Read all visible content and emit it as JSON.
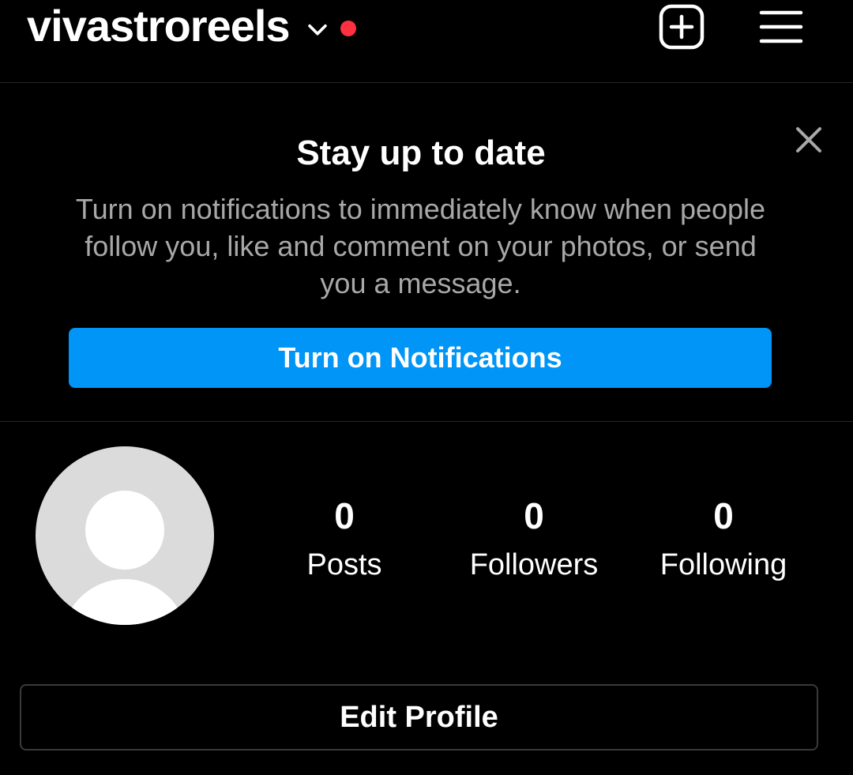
{
  "header": {
    "username": "vivastroreels",
    "chevron_icon": "chevron-down-icon",
    "notification_dot_color": "#ff3040",
    "new_post_icon": "plus-square-icon",
    "menu_icon": "hamburger-menu-icon"
  },
  "banner": {
    "title": "Stay up to date",
    "body": "Turn on notifications to immediately know when people follow you, like and comment on your photos, or send you a message.",
    "button_label": "Turn on Notifications",
    "button_color": "#0095f6",
    "close_icon": "close-icon"
  },
  "profile": {
    "avatar_icon": "default-avatar-icon",
    "stats": [
      {
        "count": "0",
        "label": "Posts"
      },
      {
        "count": "0",
        "label": "Followers"
      },
      {
        "count": "0",
        "label": "Following"
      }
    ],
    "edit_button_label": "Edit Profile"
  }
}
